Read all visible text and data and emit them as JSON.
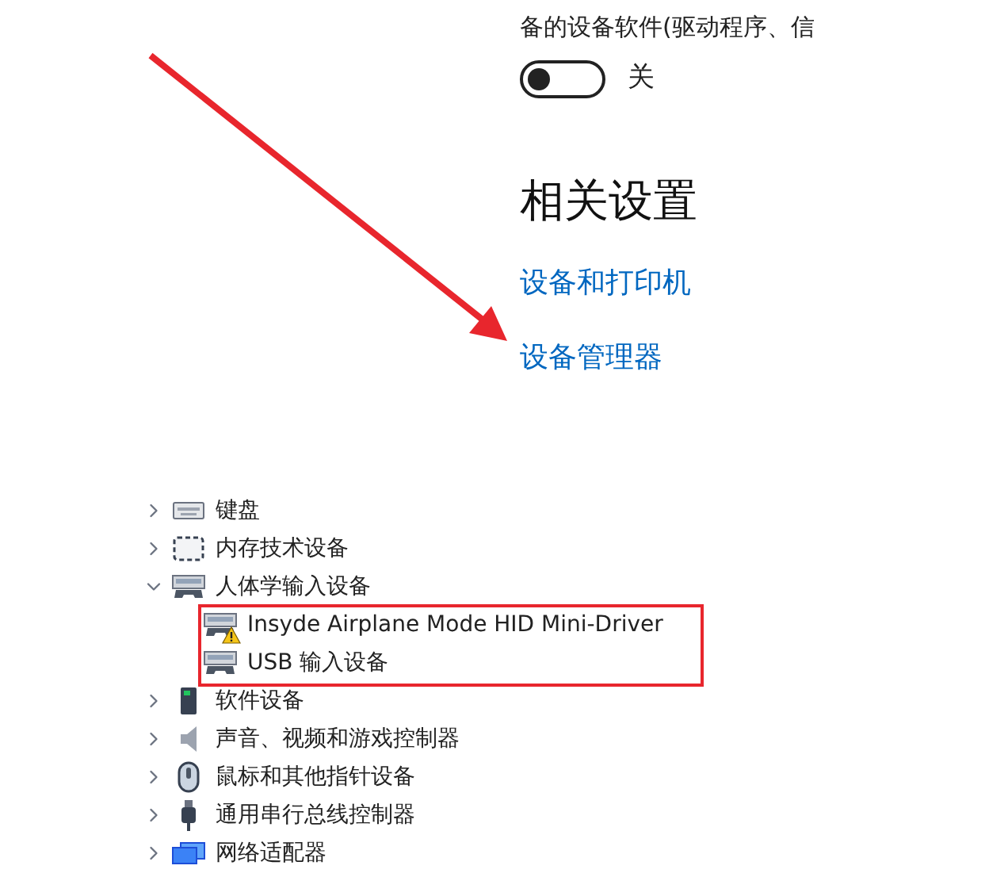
{
  "settings": {
    "description_cut": "备的设备软件(驱动程序、信",
    "toggle": {
      "on": false,
      "label": "关"
    },
    "heading": "相关设置",
    "links": [
      "设备和打印机",
      "设备管理器"
    ]
  },
  "device_tree": [
    {
      "label": "键盘",
      "kind": "keyboard",
      "expanded": false
    },
    {
      "label": "内存技术设备",
      "kind": "memory",
      "expanded": false
    },
    {
      "label": "人体学输入设备",
      "kind": "hid",
      "expanded": true,
      "children": [
        {
          "label": "Insyde Airplane Mode HID Mini-Driver",
          "kind": "hid",
          "warning": true
        },
        {
          "label": "USB 输入设备",
          "kind": "hid",
          "warning": false
        }
      ]
    },
    {
      "label": "软件设备",
      "kind": "software",
      "expanded": false
    },
    {
      "label": "声音、视频和游戏控制器",
      "kind": "sound",
      "expanded": false
    },
    {
      "label": "鼠标和其他指针设备",
      "kind": "mouse",
      "expanded": false
    },
    {
      "label": "通用串行总线控制器",
      "kind": "usb",
      "expanded": false
    },
    {
      "label": "网络适配器",
      "kind": "network",
      "expanded": false
    }
  ]
}
